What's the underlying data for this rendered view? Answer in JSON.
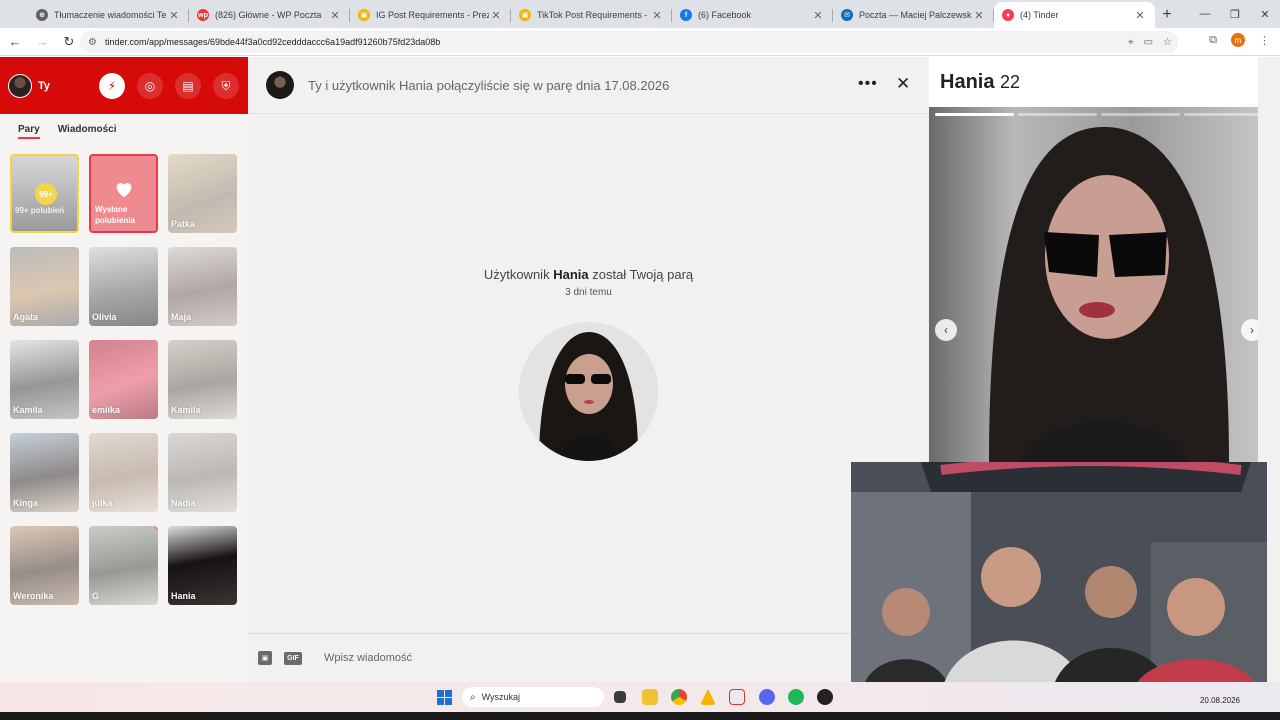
{
  "browser": {
    "tabs": [
      {
        "title": "Tłumaczenie wiadomości Temu",
        "color": "#5f6368",
        "glyph": "⊕"
      },
      {
        "title": "(826) Główne - WP Poczta",
        "color": "#e53935",
        "glyph": "wp"
      },
      {
        "title": "IG Post Requirements - Prezem",
        "color": "#f4b400",
        "glyph": "▣"
      },
      {
        "title": "TikTok Post Requirements - Pre",
        "color": "#f4b400",
        "glyph": "▣"
      },
      {
        "title": "(6) Facebook",
        "color": "#1877f2",
        "glyph": "f"
      },
      {
        "title": "Poczta — Maciej Palczewski —",
        "color": "#0f6cbd",
        "glyph": "✉"
      },
      {
        "title": "(4) Tinder",
        "color": "#fd3a5c",
        "glyph": "♦"
      }
    ],
    "new_tab": "+",
    "url": "tinder.com/app/messages/69bde44f3a0cd92cedddaccc6a19adf91260b75fd23da08b",
    "profile_initial": "m"
  },
  "sidebar": {
    "user_label": "Ty",
    "tabs": [
      "Pary",
      "Wiadomości"
    ],
    "likes_card": {
      "badge": "99+",
      "text": "99+ polubień"
    },
    "sent_card": {
      "text_line1": "Wysłane",
      "text_line2": "polubienia"
    },
    "matches": [
      {
        "name": "Patka",
        "bg": "linear-gradient(160deg,#d8c7a3,#9a8b7b 60%,#b7a58e)",
        "dot": false,
        "faded": true
      },
      {
        "name": "Agata",
        "bg": "linear-gradient(170deg,#8e8e8e,#c9a27a 55%,#6f6f6f)",
        "dot": false,
        "faded": true
      },
      {
        "name": "Olivia",
        "bg": "linear-gradient(170deg,#cfcfcf,#6a6a6a 55%,#2d2d2d)",
        "dot": false,
        "faded": true
      },
      {
        "name": "Maja",
        "bg": "linear-gradient(170deg,#c9c4c0,#7a6864 55%,#b4aaa5)",
        "dot": false,
        "faded": true
      },
      {
        "name": "Kamila",
        "bg": "linear-gradient(170deg,#d8d8d8,#4a4a4a 55%,#9f9f9f)",
        "dot": false,
        "faded": true
      },
      {
        "name": "emiika",
        "bg": "linear-gradient(160deg,#b8243a,#e85a6d 55%,#8a1a2b)",
        "dot": true,
        "faded": true
      },
      {
        "name": "Kamila",
        "bg": "linear-gradient(170deg,#b9b2a6,#6d655e 55%,#c9c2b8)",
        "dot": false,
        "faded": true
      },
      {
        "name": "Kinga",
        "bg": "linear-gradient(170deg,#9fb2c4,#3d3634 55%,#c4b7a8)",
        "dot": false,
        "faded": true
      },
      {
        "name": "julka",
        "bg": "linear-gradient(170deg,#d2c3b5,#a28b78 55%,#ddd1c6)",
        "dot": false,
        "faded": true
      },
      {
        "name": "Nadia",
        "bg": "linear-gradient(170deg,#c4c0bd,#8c8783 55%,#d2cecb)",
        "dot": false,
        "faded": true
      },
      {
        "name": "Weronika",
        "bg": "linear-gradient(170deg,#c9a382,#4b3a33 55%,#a98c77)",
        "dot": false,
        "faded": true
      },
      {
        "name": "G",
        "bg": "linear-gradient(170deg,#a7aea4,#4c5048 55%,#bfc3bb)",
        "dot": true,
        "faded": true
      },
      {
        "name": "Hania",
        "bg": "linear-gradient(170deg,#e0dedd,#161312 45%,#3a3332)",
        "dot": false,
        "faded": false
      }
    ]
  },
  "chat": {
    "header_text": "Ty i użytkownik Hania połączyliście się w parę dnia 17.08.2026",
    "match_prefix": "Użytkownik",
    "match_name": "Hania",
    "match_suffix": "został Twoją parą",
    "match_time": "3 dni temu",
    "gif_label": "GIF",
    "input_placeholder": "Wpisz wiadomość"
  },
  "profile": {
    "name": "Hania",
    "age": "22",
    "photo_count": 4,
    "active_photo": 1
  },
  "taskbar": {
    "search_placeholder": "Wyszukaj",
    "date": "20.08.2026"
  },
  "colors": {
    "tinder_red": "#d70a0a",
    "accent_pink": "#e8394a",
    "gold": "#f6d646"
  }
}
